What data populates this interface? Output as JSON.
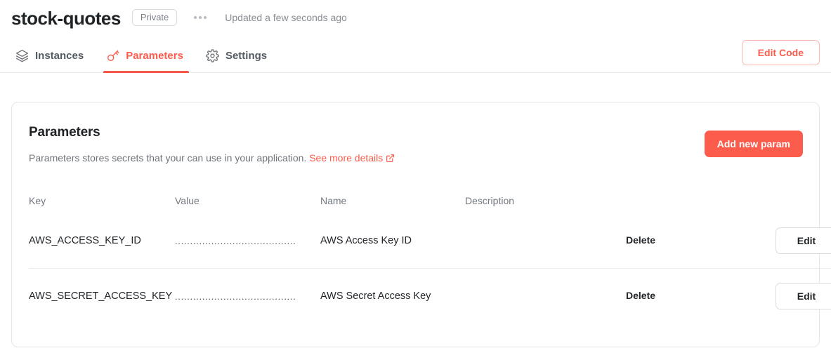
{
  "header": {
    "app_title": "stock-quotes",
    "visibility_badge": "Private",
    "menu_icon": "ellipsis-icon",
    "updated_text": "Updated a few seconds ago"
  },
  "tabs": [
    {
      "label": "Instances",
      "icon": "layers-icon",
      "active": false
    },
    {
      "label": "Parameters",
      "icon": "key-icon",
      "active": true
    },
    {
      "label": "Settings",
      "icon": "gear-icon",
      "active": false
    }
  ],
  "toolbar": {
    "edit_code_label": "Edit Code"
  },
  "card": {
    "title": "Parameters",
    "description": "Parameters stores secrets that your can use in your application.",
    "description_link": "See more details",
    "description_link_icon": "external-link-icon",
    "add_param_label": "Add new param"
  },
  "table": {
    "columns": [
      "Key",
      "Value",
      "Name",
      "Description"
    ],
    "rows": [
      {
        "key": "AWS_ACCESS_KEY_ID",
        "value": "........................................",
        "name": "AWS Access Key ID",
        "description": "",
        "delete_label": "Delete",
        "edit_label": "Edit"
      },
      {
        "key": "AWS_SECRET_ACCESS_KEY",
        "value": "........................................",
        "name": "AWS Secret Access Key",
        "description": "",
        "delete_label": "Delete",
        "edit_label": "Edit"
      }
    ]
  },
  "colors": {
    "accent": "#fb5c4c",
    "text": "#22262a",
    "muted": "#72787f",
    "border": "#e4e6e8"
  }
}
